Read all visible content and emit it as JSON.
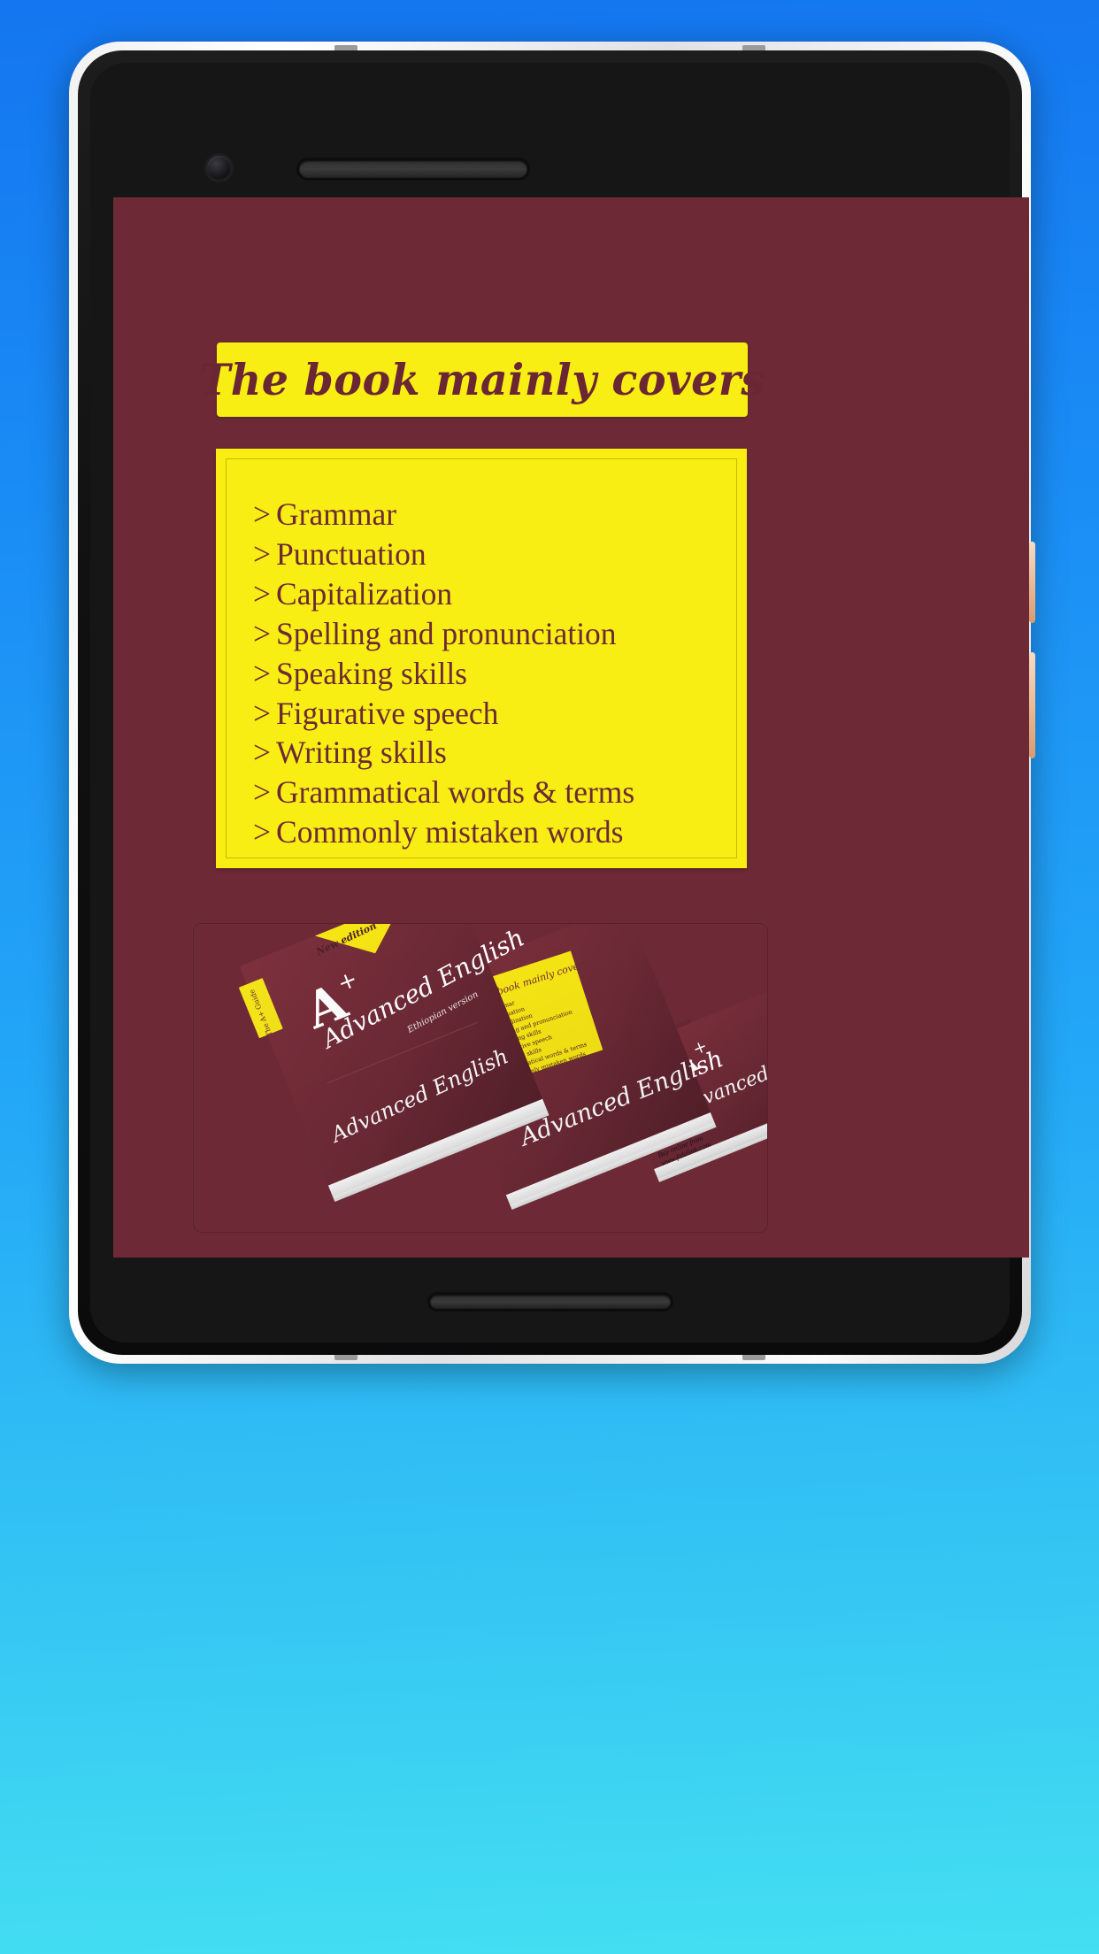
{
  "app": {
    "background_color": "#6d2a36",
    "accent_yellow": "#f8ee14",
    "text_maroon": "#6c2a34"
  },
  "header": {
    "title": "The book mainly covers"
  },
  "covers_card": {
    "marker": ">",
    "items": [
      "Grammar",
      "Punctuation",
      "Capitalization",
      "Spelling and pronunciation",
      "Speaking skills",
      "Figurative speech",
      "Writing skills",
      "Grammatical words & terms",
      "Commonly mistaken words"
    ]
  },
  "book_mockup": {
    "alt": "A+ Advanced English books mockup",
    "badge": "New edition",
    "grade_mark": "A+",
    "title": "Advanced English",
    "subtitle": "Ethiopian version",
    "spine_title": "A+ Advanced English",
    "back_panel_heading": "The book mainly covers",
    "back_panel_items": [
      "Grammar",
      "Punctuation",
      "Capitalization",
      "Spelling and pronunciation",
      "Speaking skills",
      "Figurative speech",
      "Writing skills",
      "Grammatical words & terms",
      "Commonly mistaken words"
    ],
    "footer_note": "Buy online from www.fidelink.com",
    "side_label": "The A+ Guide",
    "side_sub": "New edition"
  },
  "bottom_card": {
    "content": ""
  },
  "device": {
    "camera": "front-camera",
    "speaker": "earpiece-speaker",
    "home_bar": "home-bar"
  }
}
